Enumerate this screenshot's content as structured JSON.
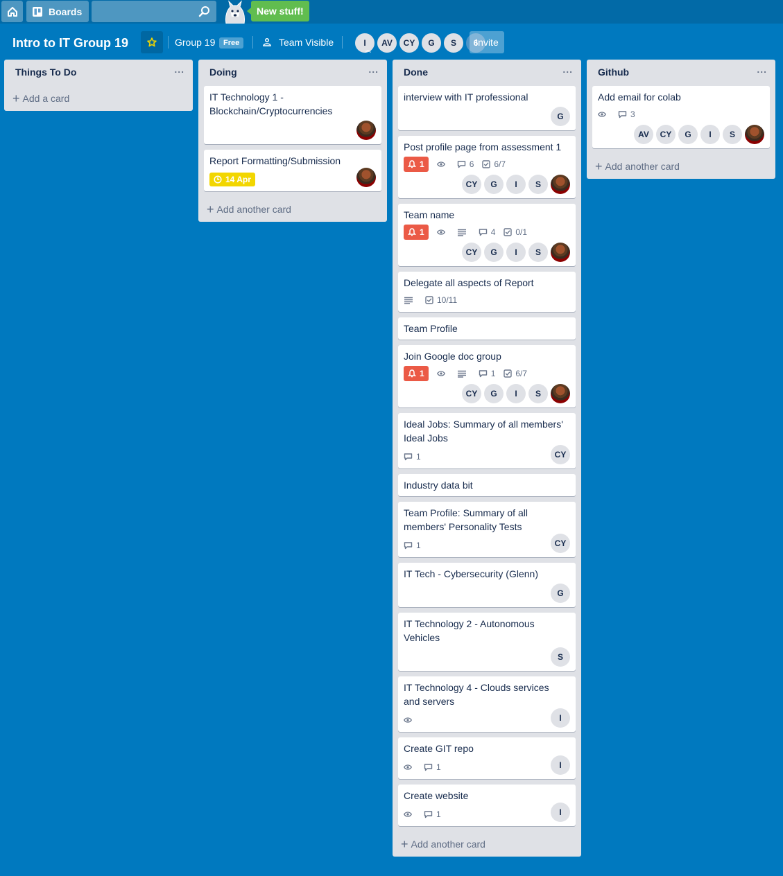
{
  "header": {
    "home_icon": "house-icon",
    "boards_label": "Boards",
    "search": {
      "value": "",
      "placeholder": ""
    },
    "new_stuff_label": "New stuff!"
  },
  "board": {
    "title": "Intro to IT Group 19",
    "team": "Group 19",
    "team_badge": "Free",
    "visibility": "Team Visible",
    "members": [
      "I",
      "AV",
      "CY",
      "G",
      "S"
    ],
    "member_count": "6",
    "invite_label": "Invite"
  },
  "colors": {
    "background": "#0079bf",
    "list_bg": "#dfe1e6",
    "label_red": "#eb5a46",
    "due_yellow": "#f2d600",
    "new_stuff_green": "#61bd4f"
  },
  "lists": [
    {
      "name": "Things To Do",
      "menu": "...",
      "add_label": "Add a card",
      "cards": []
    },
    {
      "name": "Doing",
      "menu": "...",
      "add_label": "Add another card",
      "cards": [
        {
          "title": "IT Technology 1 - Blockchain/Cryptocurrencies",
          "members": [
            "photo"
          ]
        },
        {
          "title": "Report Formatting/Submission",
          "due": "14 Apr",
          "members": [
            "photo"
          ]
        }
      ]
    },
    {
      "name": "Done",
      "menu": "...",
      "add_label": "Add another card",
      "cards": [
        {
          "title": "interview with IT professional",
          "members": [
            "G"
          ]
        },
        {
          "title": "Post profile page from assessment 1",
          "notif": "1",
          "watch": true,
          "comments": "6",
          "checklist": "6/7",
          "members": [
            "CY",
            "G",
            "I",
            "S",
            "photo"
          ]
        },
        {
          "title": "Team name",
          "notif": "1",
          "watch": true,
          "desc": true,
          "comments": "4",
          "checklist": "0/1",
          "members": [
            "CY",
            "G",
            "I",
            "S",
            "photo"
          ]
        },
        {
          "title": "Delegate all aspects of Report",
          "desc": true,
          "checklist": "10/11"
        },
        {
          "title": "Team Profile"
        },
        {
          "title": "Join Google doc group",
          "notif": "1",
          "watch": true,
          "desc": true,
          "comments": "1",
          "checklist": "6/7",
          "members": [
            "CY",
            "G",
            "I",
            "S",
            "photo"
          ]
        },
        {
          "title": "Ideal Jobs: Summary of all members' Ideal Jobs",
          "comments": "1",
          "members": [
            "CY"
          ]
        },
        {
          "title": "Industry data bit"
        },
        {
          "title": "Team Profile: Summary of all members' Personality Tests",
          "comments": "1",
          "members": [
            "CY"
          ]
        },
        {
          "title": "IT Tech - Cybersecurity (Glenn)",
          "members": [
            "G"
          ]
        },
        {
          "title": "IT Technology 2 - Autonomous Vehicles",
          "members": [
            "S"
          ]
        },
        {
          "title": "IT Technology 4 - Clouds services and servers",
          "watch": true,
          "members": [
            "I"
          ]
        },
        {
          "title": "Create GIT repo",
          "watch": true,
          "comments": "1",
          "members": [
            "I"
          ]
        },
        {
          "title": "Create website",
          "watch": true,
          "comments": "1",
          "members": [
            "I"
          ]
        }
      ]
    },
    {
      "name": "Github",
      "menu": "...",
      "add_label": "Add another card",
      "cards": [
        {
          "title": "Add email for colab",
          "watch": true,
          "comments": "3",
          "members": [
            "AV",
            "CY",
            "G",
            "I",
            "S",
            "photo"
          ]
        }
      ]
    }
  ]
}
